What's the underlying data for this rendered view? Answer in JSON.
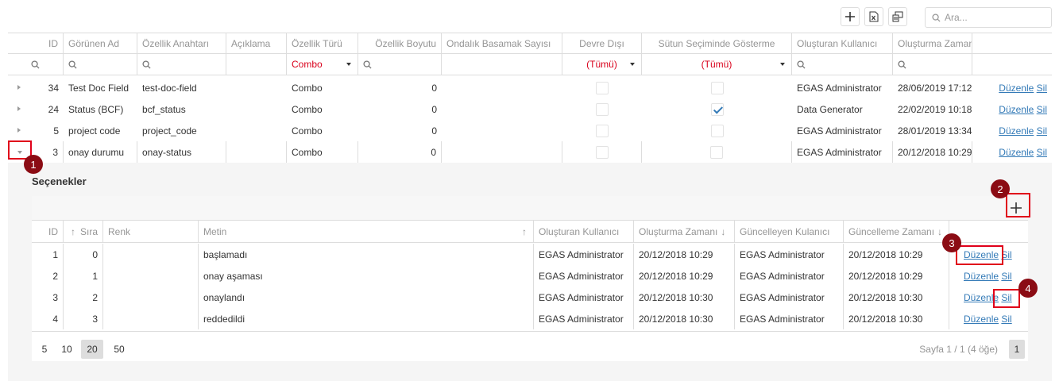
{
  "toolbar": {
    "add_icon": "plus-icon",
    "export_icon": "excel-export-icon",
    "columns_icon": "column-chooser-icon",
    "search_placeholder": "Ara..."
  },
  "grid": {
    "headers": [
      "ID",
      "Görünen Ad",
      "Özellik Anahtarı",
      "Açıklama",
      "Özellik Türü",
      "Özellik Boyutu",
      "Ondalık Basamak Sayısı",
      "Devre Dışı",
      "Sütun Seçiminde Gösterme",
      "Oluşturan Kullanıcı",
      "Oluşturma Zamanı"
    ],
    "filters": {
      "type": "Combo",
      "disabled": "(Tümü)",
      "hide": "(Tümü)"
    },
    "rows": [
      {
        "id": "34",
        "name": "Test Doc Field",
        "key": "test-doc-field",
        "desc": "",
        "type": "Combo",
        "size": "0",
        "decimals": "",
        "disabled": false,
        "hide": false,
        "creator": "EGAS Administrator",
        "created": "28/06/2019 17:12",
        "edit": "Düzenle",
        "delete": "Sil"
      },
      {
        "id": "24",
        "name": "Status (BCF)",
        "key": "bcf_status",
        "desc": "",
        "type": "Combo",
        "size": "0",
        "decimals": "",
        "disabled": false,
        "hide": true,
        "creator": "Data Generator",
        "created": "22/02/2019 10:18",
        "edit": "Düzenle",
        "delete": "Sil"
      },
      {
        "id": "5",
        "name": "project code",
        "key": "project_code",
        "desc": "",
        "type": "Combo",
        "size": "0",
        "decimals": "",
        "disabled": false,
        "hide": false,
        "creator": "EGAS Administrator",
        "created": "28/01/2019 13:34",
        "edit": "Düzenle",
        "delete": "Sil"
      },
      {
        "id": "3",
        "name": "onay durumu",
        "key": "onay-status",
        "desc": "",
        "type": "Combo",
        "size": "0",
        "decimals": "",
        "disabled": false,
        "hide": false,
        "creator": "EGAS Administrator",
        "created": "20/12/2018 10:29",
        "edit": "Düzenle",
        "delete": "Sil"
      }
    ]
  },
  "detail": {
    "title": "Seçenekler",
    "headers": [
      "ID",
      "Sıra",
      "Renk",
      "Metin",
      "Oluşturan Kullanıcı",
      "Oluşturma Zamanı",
      "Güncelleyen Kulanıcı",
      "Güncelleme Zamanı"
    ],
    "rows": [
      {
        "id": "1",
        "order": "0",
        "color": "",
        "text": "başlamadı",
        "creator": "EGAS Administrator",
        "created": "20/12/2018 10:29",
        "updater": "EGAS Administrator",
        "updated": "20/12/2018 10:29",
        "edit": "Düzenle",
        "delete": "Sil"
      },
      {
        "id": "2",
        "order": "1",
        "color": "",
        "text": "onay aşaması",
        "creator": "EGAS Administrator",
        "created": "20/12/2018 10:29",
        "updater": "EGAS Administrator",
        "updated": "20/12/2018 10:29",
        "edit": "Düzenle",
        "delete": "Sil"
      },
      {
        "id": "3",
        "order": "2",
        "color": "",
        "text": "onaylandı",
        "creator": "EGAS Administrator",
        "created": "20/12/2018 10:30",
        "updater": "EGAS Administrator",
        "updated": "20/12/2018 10:30",
        "edit": "Düzenle",
        "delete": "Sil"
      },
      {
        "id": "4",
        "order": "3",
        "color": "",
        "text": "reddedildi",
        "creator": "EGAS Administrator",
        "created": "20/12/2018 10:30",
        "updater": "EGAS Administrator",
        "updated": "20/12/2018 10:30",
        "edit": "Düzenle",
        "delete": "Sil"
      }
    ],
    "page_sizes": [
      "5",
      "10",
      "20",
      "50"
    ],
    "page_info": "Sayfa 1 / 1 (4 öğe)",
    "current_page": "1"
  },
  "annotations": [
    "1",
    "2",
    "3",
    "4"
  ],
  "colors": {
    "accent": "#337ab7",
    "filter_red": "#d9001b",
    "annotation": "#e0001a",
    "badge": "#8b0c14"
  }
}
